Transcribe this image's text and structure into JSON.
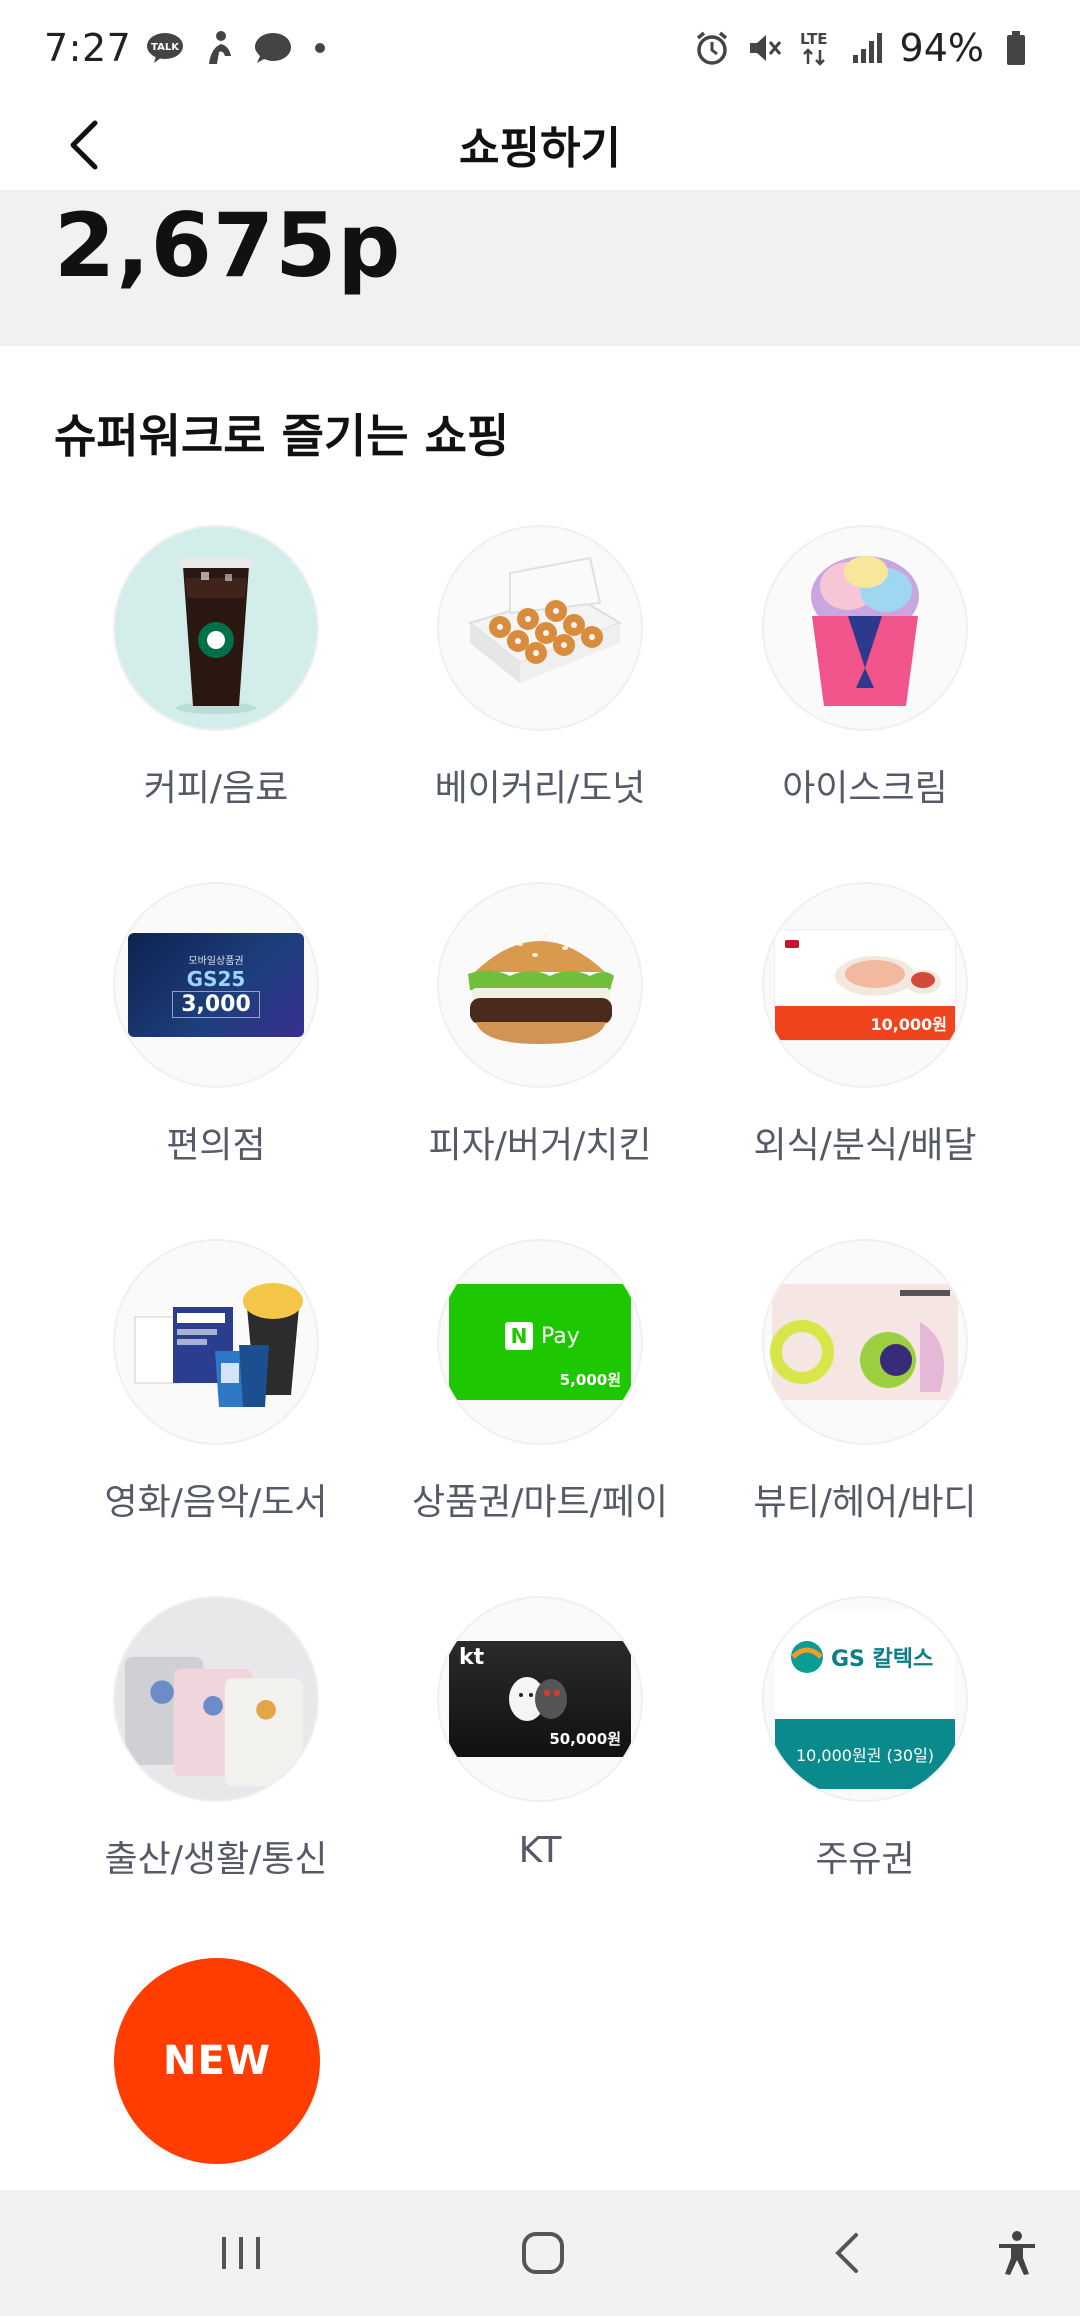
{
  "status": {
    "time": "7:27",
    "battery_text": "94%",
    "network": "LTE"
  },
  "header": {
    "title": "쇼핑하기"
  },
  "points": {
    "value": "2,675p"
  },
  "section": {
    "title": "슈퍼워크로 즐기는 쇼핑"
  },
  "categories": [
    {
      "label": "커피/음료",
      "icon": "iced-coffee-icon"
    },
    {
      "label": "베이커리/도넛",
      "icon": "donut-box-icon"
    },
    {
      "label": "아이스크림",
      "icon": "ice-cream-cup-icon"
    },
    {
      "label": "편의점",
      "icon": "gs25-voucher-icon",
      "card_top": "모바일상품권",
      "card_brand": "GS25",
      "card_amount": "3,000"
    },
    {
      "label": "피자/버거/치킨",
      "icon": "burger-icon"
    },
    {
      "label": "외식/분식/배달",
      "icon": "restaurant-voucher-icon",
      "card_amount": "10,000원"
    },
    {
      "label": "영화/음악/도서",
      "icon": "movie-ticket-icon"
    },
    {
      "label": "상품권/마트/페이",
      "icon": "naver-pay-card-icon",
      "card_brand": "Pay",
      "card_amount": "5,000원"
    },
    {
      "label": "뷰티/헤어/바디",
      "icon": "olive-young-card-icon"
    },
    {
      "label": "출산/생활/통신",
      "icon": "towels-icon"
    },
    {
      "label": "KT",
      "icon": "kt-card-icon",
      "card_brand": "kt",
      "card_amount": "50,000원"
    },
    {
      "label": "주유권",
      "icon": "gs-caltex-card-icon",
      "card_brand": "GS 칼텍스",
      "card_amount": "10,000원권 (30일)"
    }
  ],
  "new_badge": {
    "label": "NEW"
  },
  "colors": {
    "accent": "#ff3d00",
    "band": "#f1f1f3",
    "label": "#555b66"
  }
}
